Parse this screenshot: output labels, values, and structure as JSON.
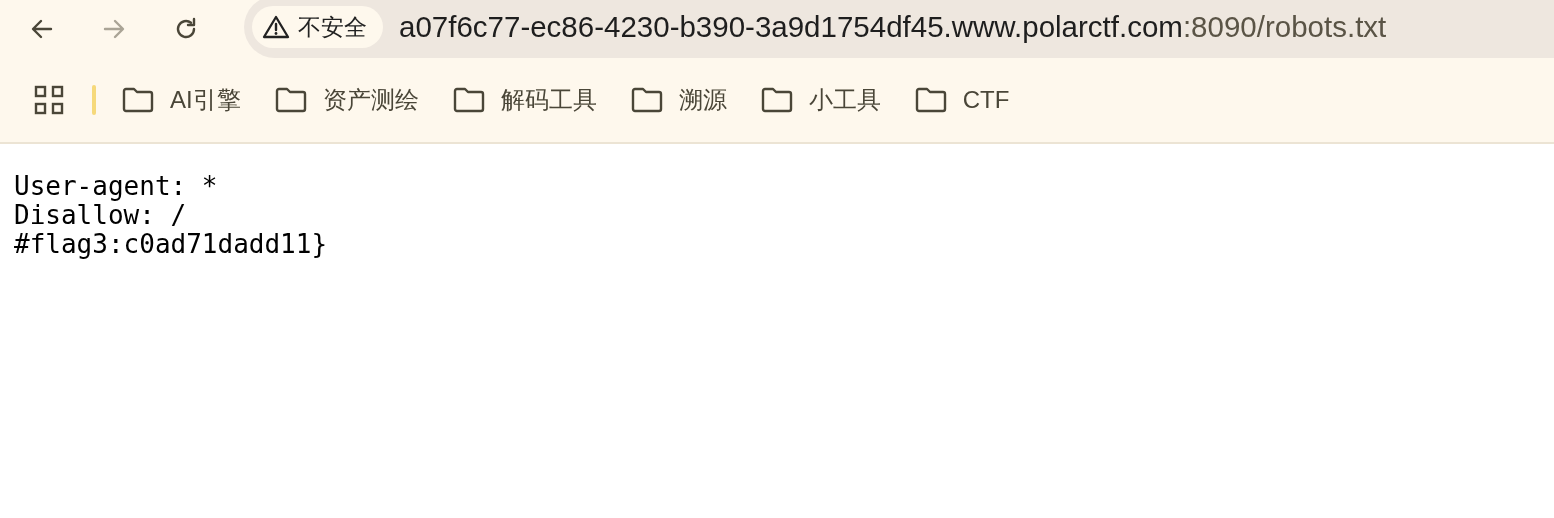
{
  "toolbar": {
    "back": {
      "disabled": false
    },
    "forward": {
      "disabled": true
    },
    "security_label": "不安全",
    "url_host": "a07f6c77-ec86-4230-b390-3a9d1754df45.www.polarctf.com",
    "url_rest": ":8090/robots.txt"
  },
  "bookmarks": [
    {
      "label": "AI引擎"
    },
    {
      "label": "资产测绘"
    },
    {
      "label": "解码工具"
    },
    {
      "label": "溯源"
    },
    {
      "label": "小工具"
    },
    {
      "label": "CTF"
    }
  ],
  "content_lines": [
    "User-agent: *",
    "Disallow: /",
    "#flag3:c0ad71dadd11}"
  ]
}
